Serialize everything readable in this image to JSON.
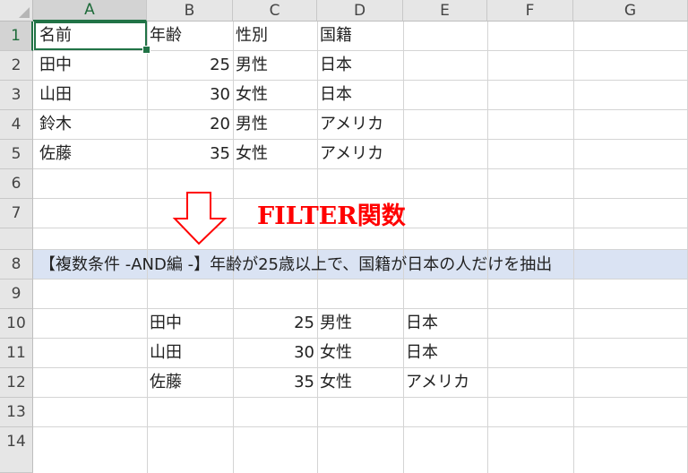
{
  "sheet": {
    "columns": [
      "A",
      "B",
      "C",
      "D",
      "E",
      "F",
      "G"
    ],
    "rows": [
      "1",
      "2",
      "3",
      "4",
      "5",
      "6",
      "7",
      "8",
      "9",
      "10",
      "11",
      "12",
      "13",
      "14"
    ],
    "active_cell": "A1",
    "selection_color": "#217346",
    "band_color": "#dae3f3"
  },
  "table": {
    "headers": [
      "名前",
      "年齢",
      "性別",
      "国籍"
    ],
    "rows": [
      [
        "田中",
        "25",
        "男性",
        "日本"
      ],
      [
        "山田",
        "30",
        "女性",
        "日本"
      ],
      [
        "鈴木",
        "20",
        "男性",
        "アメリカ"
      ],
      [
        "佐藤",
        "35",
        "女性",
        "アメリカ"
      ]
    ]
  },
  "annotation": {
    "title": "FILTER関数",
    "title_color": "#ff0000",
    "arrow_icon": "down-arrow-icon",
    "description": "【複数条件 -AND編 -】年齢が25歳以上で、国籍が日本の人だけを抽出"
  },
  "result": {
    "rows": [
      [
        "田中",
        "25",
        "男性",
        "日本"
      ],
      [
        "山田",
        "30",
        "女性",
        "日本"
      ],
      [
        "佐藤",
        "35",
        "女性",
        "アメリカ"
      ]
    ]
  }
}
